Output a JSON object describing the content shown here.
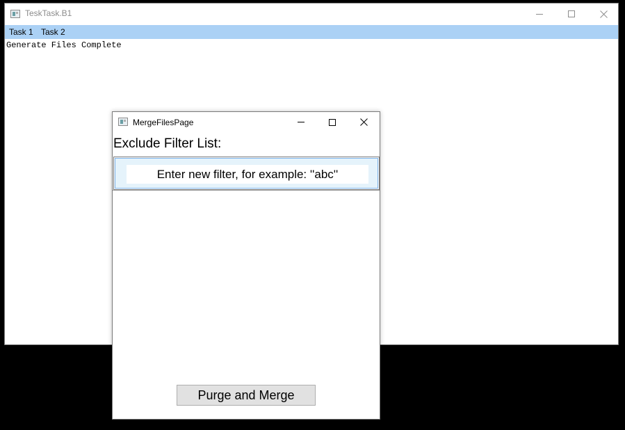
{
  "main_window": {
    "title": "TeskTask.B1",
    "icon": "app-window-icon",
    "menu": [
      {
        "label": "Task 1"
      },
      {
        "label": "Task 2"
      }
    ],
    "content_text": "Generate Files Complete",
    "caption_buttons": [
      "minimize-icon",
      "maximize-icon",
      "close-icon"
    ]
  },
  "dialog": {
    "title": "MergeFilesPage",
    "icon": "app-window-icon",
    "caption_buttons": [
      "minimize-icon",
      "maximize-icon",
      "close-icon"
    ],
    "filter_heading": "Exclude Filter List:",
    "filter_input": {
      "value": "",
      "placeholder": "Enter new filter, for example: ''abc''"
    },
    "purge_button_label": "Purge and Merge"
  },
  "colors": {
    "menubar": "#abd1f5",
    "selected_row": "#e5f3fb",
    "selected_row_border": "#7eb4ea",
    "button_face": "#e1e1e1",
    "desktop": "#000000"
  }
}
